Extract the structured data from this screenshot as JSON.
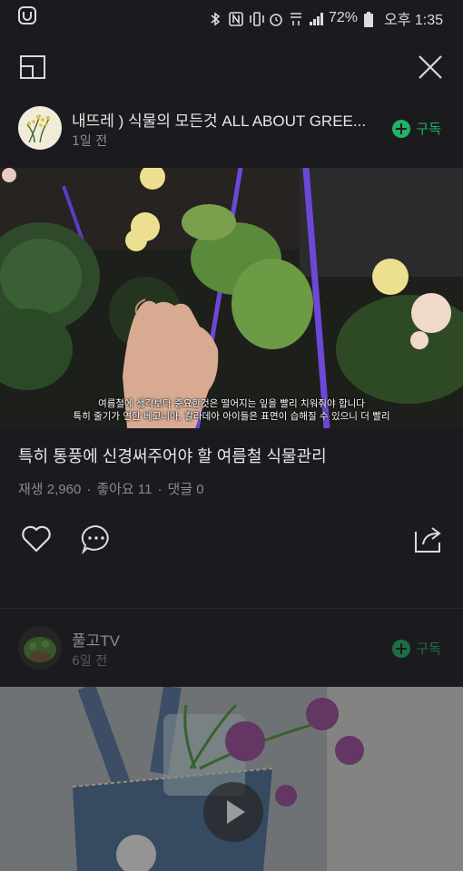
{
  "status_bar": {
    "battery": "72%",
    "time": "오후 1:35",
    "icons": [
      "app-icon",
      "bluetooth-icon",
      "nfc-icon",
      "vibrate-icon",
      "alarm-icon",
      "data-icon",
      "signal-icon",
      "battery-icon"
    ]
  },
  "toolbar": {
    "icons": [
      "picture-in-picture-icon",
      "close-icon"
    ]
  },
  "post1": {
    "channel_name": "내뜨레 ) 식물의 모든것 ALL ABOUT GREE...",
    "time_ago": "1일 전",
    "subscribe_label": "구독",
    "subtitle_line1": "여름철에 생각보다 중요한것은 떨어지는 잎을 빨리 치워줘야 합니다",
    "subtitle_line2": "특히 줄기가 연한 베고니아, 칼라데아 아이들은 표면이 습해질 수 있으니 더 빨리",
    "video_title": "특히 통풍에 신경써주어야 할 여름철 식물관리",
    "views": "재생 2,960",
    "likes": "좋아요 11",
    "comments": "댓글 0",
    "action_icons": [
      "heart-icon",
      "comment-icon",
      "share-icon"
    ]
  },
  "post2": {
    "channel_name": "풀고TV",
    "time_ago": "6일 전",
    "subscribe_label": "구독",
    "icons": [
      "play-icon"
    ]
  },
  "colors": {
    "background": "#1b1b1f",
    "accent_green": "#20b265",
    "muted_text": "#8a8a8a"
  }
}
